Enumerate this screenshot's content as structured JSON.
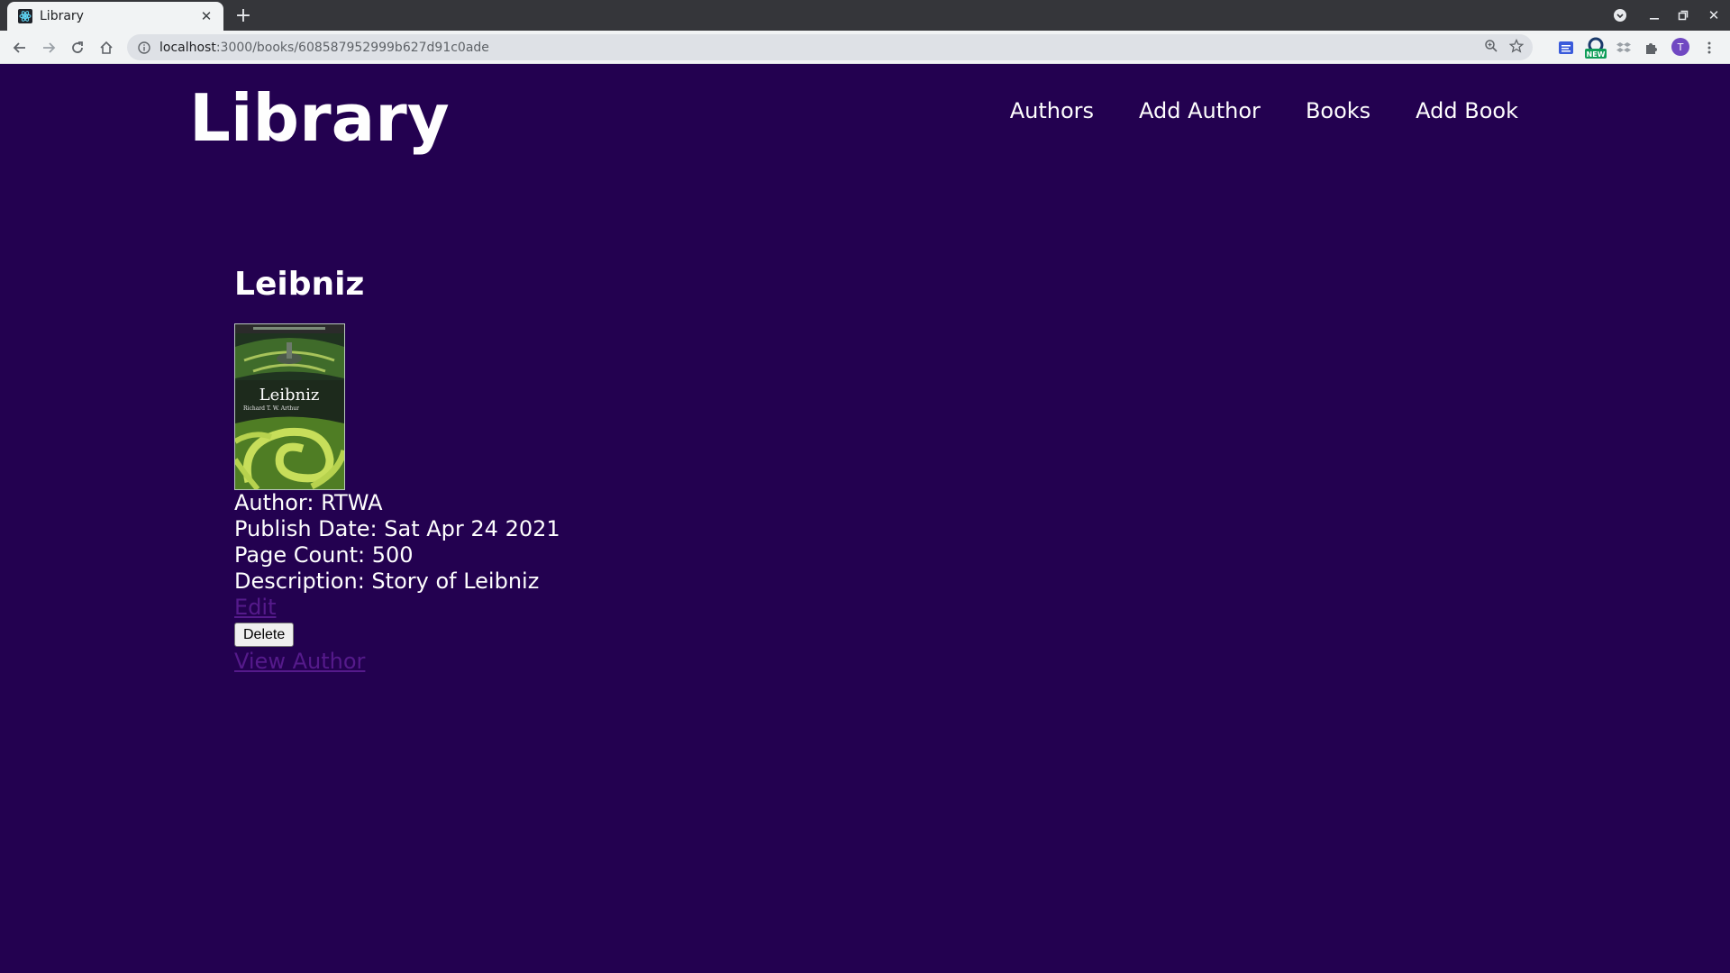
{
  "browser": {
    "tab_title": "Library",
    "url_host": "localhost",
    "url_path": ":3000/books/608587952999b627d91c0ade",
    "ext_new_badge": "NEW",
    "profile_initial": "T"
  },
  "site": {
    "title": "Library",
    "nav": [
      "Authors",
      "Add Author",
      "Books",
      "Add Book"
    ]
  },
  "book": {
    "title": "Leibniz",
    "cover_title": "Leibniz",
    "cover_author": "Richard T. W. Arthur",
    "author_label": "Author:",
    "author": "RTWA",
    "publish_label": "Publish Date:",
    "publish_date": "Sat Apr 24 2021",
    "pages_label": "Page Count:",
    "page_count": "500",
    "description_label": "Description:",
    "description": "Story of Leibniz",
    "edit_label": "Edit",
    "delete_label": "Delete",
    "view_author_label": "View Author"
  },
  "colors": {
    "page_background": "#230150",
    "text": "#fefefe",
    "visited_link": "#551a8b"
  }
}
